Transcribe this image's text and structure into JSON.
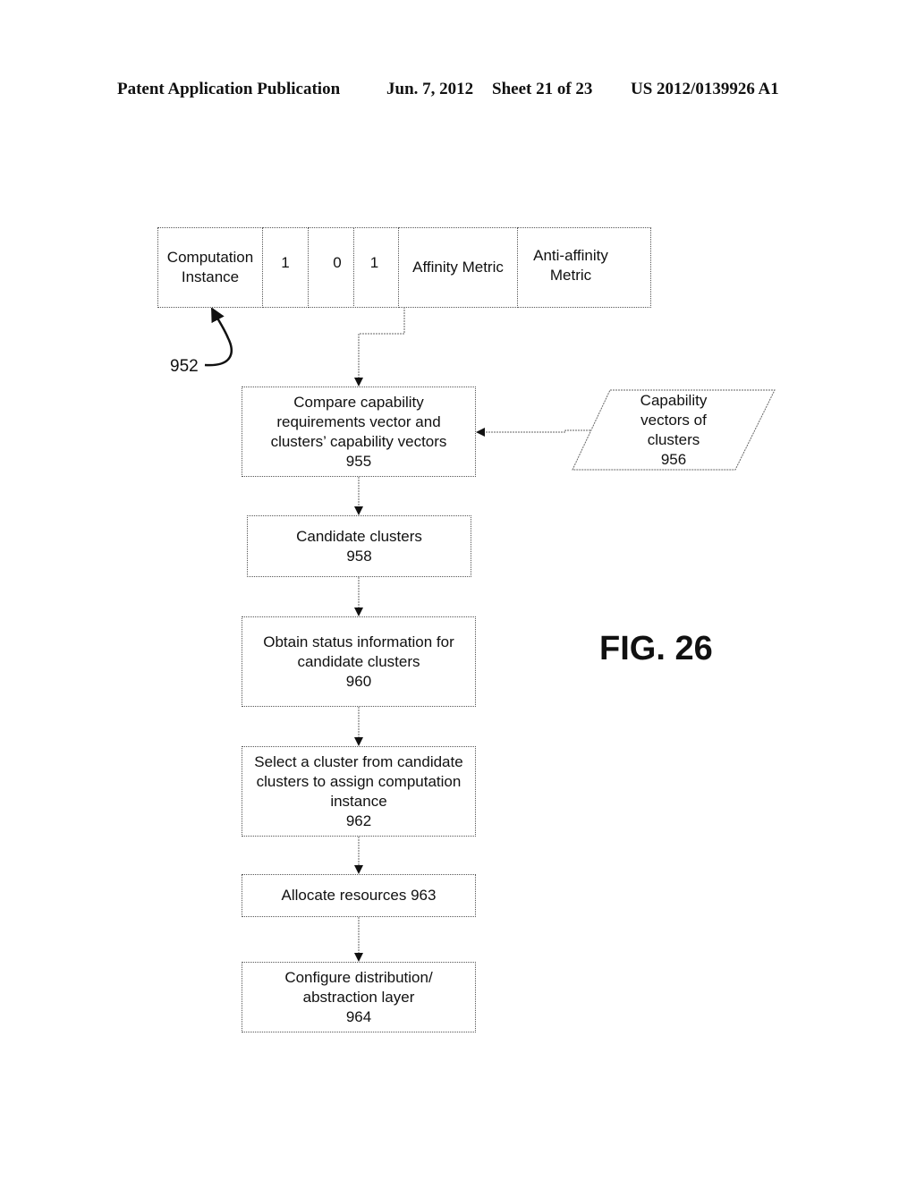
{
  "header": {
    "publication": "Patent Application Publication",
    "date": "Jun. 7, 2012",
    "sheet": "Sheet 21 of 23",
    "number": "US 2012/0139926 A1"
  },
  "vector_table": {
    "cells": [
      {
        "line1": "Computation",
        "line2": "Instance"
      },
      {
        "line1": "1",
        "line2": ""
      },
      {
        "line1": "0",
        "line2": ""
      },
      {
        "line1": "1",
        "line2": ""
      },
      {
        "line1": "Affinity Metric",
        "line2": ""
      },
      {
        "line1": "Anti-affinity",
        "line2": "Metric"
      }
    ],
    "ref_label": "952"
  },
  "steps": [
    {
      "lines": [
        "Compare capability",
        "requirements vector and",
        "clusters’ capability vectors",
        "955"
      ]
    },
    {
      "lines": [
        "Candidate clusters",
        "958"
      ]
    },
    {
      "lines": [
        "Obtain status information for",
        "candidate clusters",
        "960"
      ]
    },
    {
      "lines": [
        "Select a cluster from candidate",
        "clusters to assign computation",
        "instance",
        "962"
      ]
    },
    {
      "lines": [
        "Allocate resources 963"
      ]
    },
    {
      "lines": [
        "Configure distribution/",
        "abstraction layer",
        "964"
      ]
    }
  ],
  "input_data": {
    "lines": [
      "Capability",
      "vectors of",
      "clusters",
      "956"
    ]
  },
  "figure_label": "FIG. 26"
}
